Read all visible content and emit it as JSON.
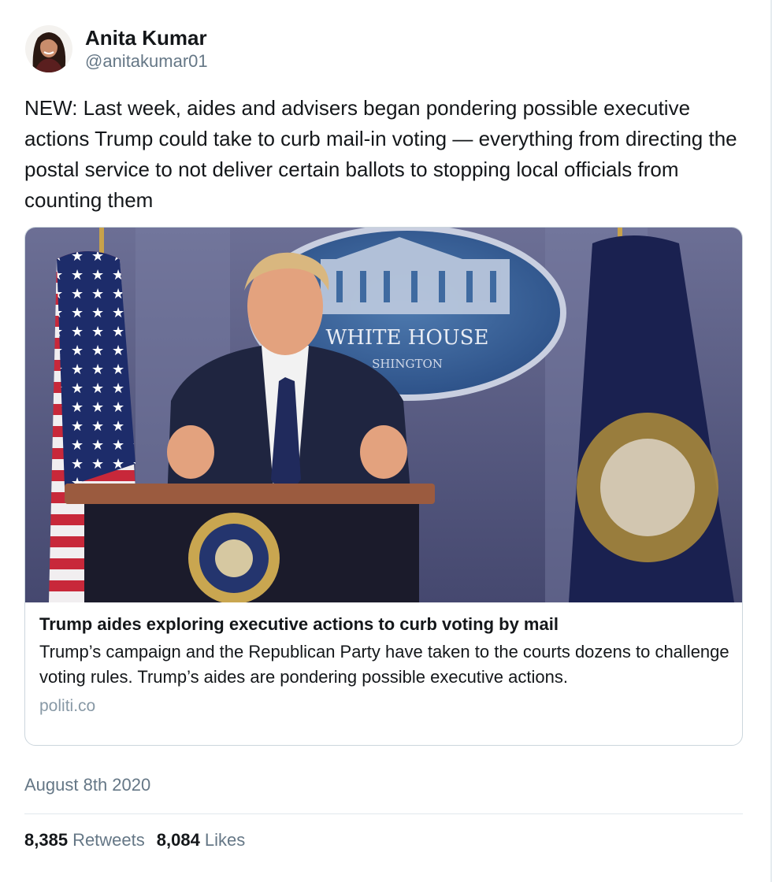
{
  "author": {
    "display_name": "Anita Kumar",
    "handle": "@anitakumar01"
  },
  "tweet": {
    "text": "NEW: Last week, aides and advisers began pondering possible executive actions Trump could take to curb mail-in voting — everything from directing the postal service to not deliver certain ballots to stopping local officials from counting them"
  },
  "card": {
    "image_text": "WHITE HOUSE",
    "image_subtext": "SHINGTON",
    "title": "Trump aides exploring executive actions to curb voting by mail",
    "description": "Trump’s campaign and the Republican Party have taken to the courts dozens to challenge voting rules. Trump’s aides are pondering possible executive actions.",
    "domain": "politi.co"
  },
  "timestamp": "August 8th 2020",
  "stats": {
    "retweets_count": "8,385",
    "retweets_label": "Retweets",
    "likes_count": "8,084",
    "likes_label": "Likes"
  },
  "colors": {
    "text": "#14171a",
    "secondary": "#657786",
    "border": "#ccd6dd"
  }
}
